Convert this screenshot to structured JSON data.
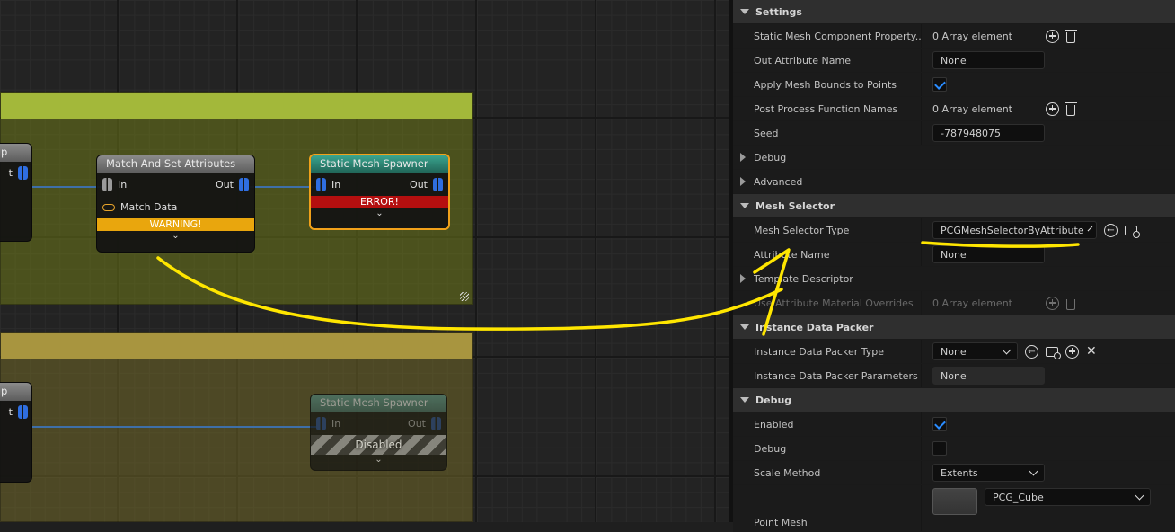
{
  "graph": {
    "nodes": {
      "cut_top": {
        "title": "p",
        "out_label": "t"
      },
      "match_set": {
        "title": "Match And Set Attributes",
        "in_label": "In",
        "out_label": "Out",
        "match_data_label": "Match Data",
        "status": "WARNING!"
      },
      "spawner_top": {
        "title": "Static Mesh Spawner",
        "in_label": "In",
        "out_label": "Out",
        "status": "ERROR!"
      },
      "cut_bottom": {
        "title": "p",
        "out_label": "t"
      },
      "spawner_bottom": {
        "title": "Static Mesh Spawner",
        "in_label": "In",
        "out_label": "Out",
        "status": "Disabled"
      }
    },
    "colors": {
      "warning": "#e9a60d",
      "error": "#b50f0f",
      "selection": "#f1a11a",
      "annotation": "#ffe600",
      "wire": "#3e6fa8"
    }
  },
  "panel": {
    "settings": {
      "header": "Settings",
      "rows": [
        {
          "label": "Static Mesh Component Property...",
          "value": "0 Array element"
        },
        {
          "label": "Out Attribute Name",
          "value": "None"
        },
        {
          "label": "Apply Mesh Bounds to Points",
          "checked": true
        },
        {
          "label": "Post Process Function Names",
          "value": "0 Array element"
        },
        {
          "label": "Seed",
          "value": "-787948075"
        },
        {
          "label": "Debug"
        },
        {
          "label": "Advanced"
        }
      ]
    },
    "mesh_selector": {
      "header": "Mesh Selector",
      "type_label": "Mesh Selector Type",
      "type_value": "PCGMeshSelectorByAttribute",
      "attribute_label": "Attribute Name",
      "attribute_value": "None",
      "template_label": "Template Descriptor",
      "overrides_label": "Use Attribute Material Overrides",
      "overrides_value": "0 Array element"
    },
    "instance_packer": {
      "header": "Instance Data Packer",
      "type_label": "Instance Data Packer Type",
      "type_value": "None",
      "params_label": "Instance Data Packer Parameters",
      "params_value": "None"
    },
    "debug": {
      "header": "Debug",
      "enabled_label": "Enabled",
      "enabled": true,
      "debug_label": "Debug",
      "debug": false,
      "scale_label": "Scale Method",
      "scale_value": "Extents",
      "point_mesh_label": "Point Mesh",
      "point_mesh_value": "PCG_Cube"
    }
  }
}
